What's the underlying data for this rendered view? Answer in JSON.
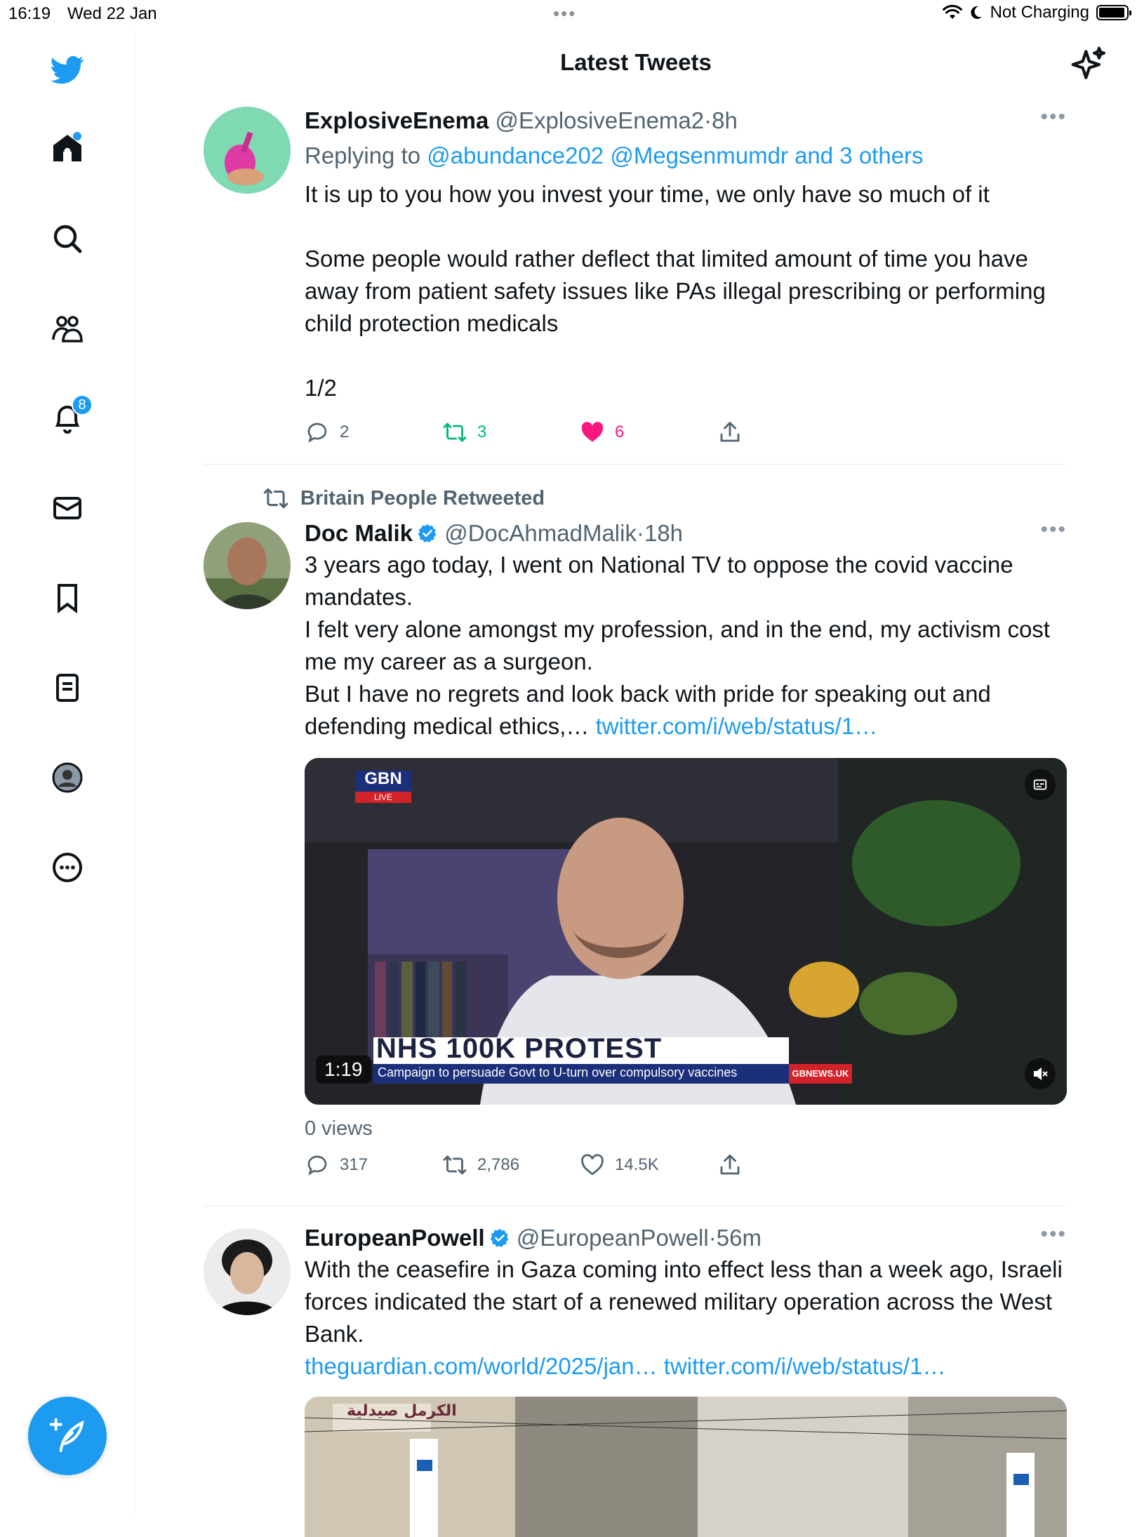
{
  "status_bar": {
    "time": "16:19",
    "date": "Wed 22 Jan",
    "dots": "•••",
    "battery_text": "Not Charging"
  },
  "header": {
    "title": "Latest Tweets"
  },
  "sidebar": {
    "items": [
      {
        "name": "home",
        "icon": "home-icon"
      },
      {
        "name": "search",
        "icon": "search-icon"
      },
      {
        "name": "communities",
        "icon": "people-icon"
      },
      {
        "name": "notifications",
        "icon": "bell-icon",
        "badge": "8"
      },
      {
        "name": "messages",
        "icon": "mail-icon"
      },
      {
        "name": "bookmarks",
        "icon": "bookmark-icon"
      },
      {
        "name": "lists",
        "icon": "list-icon"
      },
      {
        "name": "profile",
        "icon": "profile-icon"
      },
      {
        "name": "more",
        "icon": "more-circle-icon"
      }
    ],
    "compose_icon": "compose-feather-icon"
  },
  "tweets": [
    {
      "name": "ExplosiveEnema",
      "handle": "@ExplosiveEnema2",
      "sep": "·",
      "time": "8h",
      "replying_prefix": "Replying to",
      "replying_to": "@abundance202 @Megsenmumdr and 3 others",
      "text": "It is up to you how you invest your time, we only have so much of it\n\nSome people would rather deflect that limited amount of time you have away from patient safety issues like PAs illegal prescribing or performing child protection medicals\n\n1/2",
      "replies": "2",
      "retweets": "3",
      "likes": "6"
    },
    {
      "retweeted_by": "Britain People Retweeted",
      "name": "Doc Malik",
      "handle": "@DocAhmadMalik",
      "sep": "·",
      "time": "18h",
      "text": "3 years ago today, I went on National TV to oppose the covid vaccine mandates.\nI felt very alone amongst my profession, and in the end, my activism cost me my career as a surgeon.\nBut I have no regrets and look back with pride for speaking out and defending medical ethics,… ",
      "link": "twitter.com/i/web/status/1…",
      "video": {
        "channel": "GBN",
        "live": "LIVE",
        "headline": "NHS 100K PROTEST",
        "subheadline": "Campaign to persuade Govt to U-turn over compulsory vaccines",
        "site": "GBNEWS.UK",
        "duration": "1:19"
      },
      "views": "0 views",
      "replies": "317",
      "retweets": "2,786",
      "likes": "14.5K"
    },
    {
      "name": "EuropeanPowell",
      "handle": "@EuropeanPowell",
      "sep": "·",
      "time": "56m",
      "text": "With the ceasefire in Gaza coming into effect less than a week ago, Israeli forces indicated the start of a renewed military operation across the West Bank.",
      "links": "theguardian.com/world/2025/jan… twitter.com/i/web/status/1…",
      "image_sign": "الكرمل صيدلية"
    }
  ],
  "colors": {
    "accent": "#1d9bf0",
    "retweet_green": "#00ba7c",
    "like_pink": "#f91880",
    "muted": "#536471"
  }
}
